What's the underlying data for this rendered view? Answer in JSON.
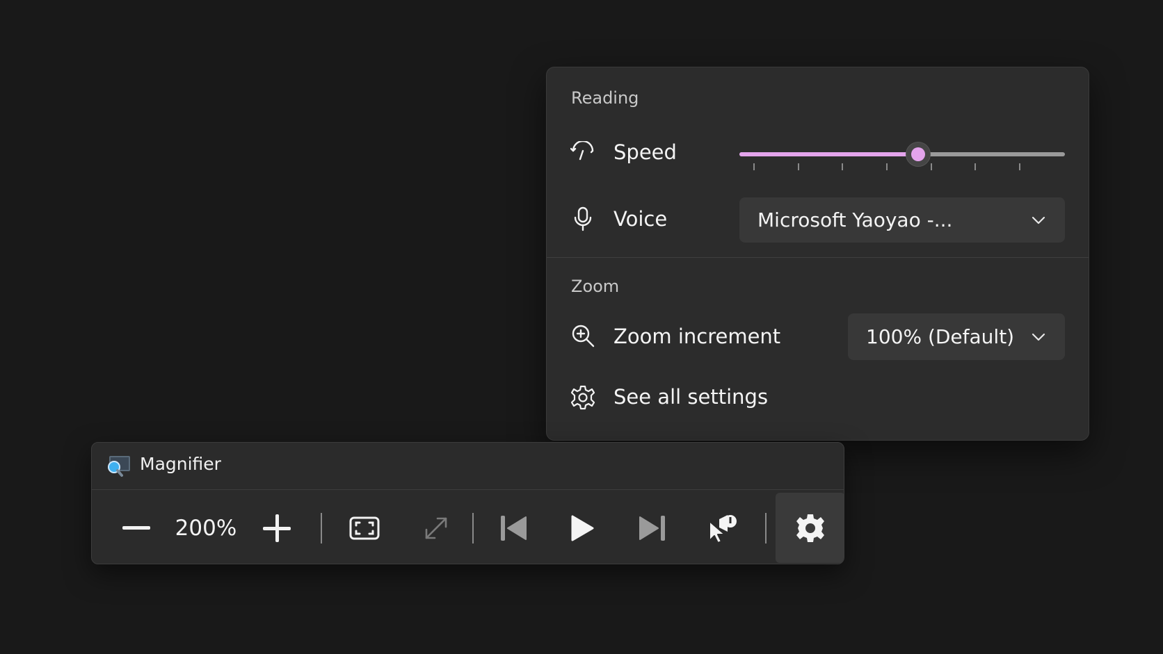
{
  "flyout": {
    "reading": {
      "title": "Reading",
      "speed": {
        "label": "Speed",
        "value": 0.55,
        "tick_count": 7
      },
      "voice": {
        "label": "Voice",
        "selected": "Microsoft Yaoyao -..."
      }
    },
    "zoom": {
      "title": "Zoom",
      "increment": {
        "label": "Zoom increment",
        "selected": "100% (Default)"
      },
      "see_all": {
        "label": "See all settings"
      }
    }
  },
  "magnifier": {
    "title": "Magnifier",
    "zoom_level": "200%",
    "icons": [
      "zoom-out-icon",
      "zoom-in-icon",
      "fullscreen-view-icon",
      "resize-lens-icon",
      "previous-paragraph-icon",
      "play-icon",
      "next-paragraph-icon",
      "read-from-pointer-icon",
      "settings-icon"
    ]
  },
  "colors": {
    "accent": "#e4a4ec",
    "background": "#191919",
    "flyout_bg": "#2c2c2c",
    "toolbar_bg": "#2b2b2b"
  }
}
